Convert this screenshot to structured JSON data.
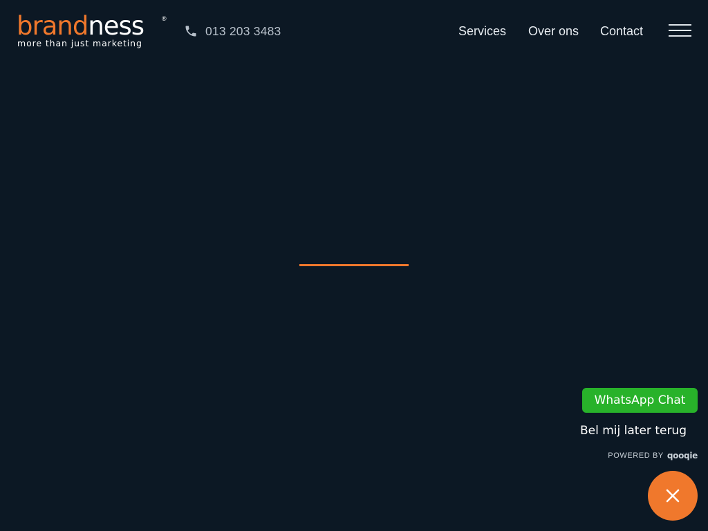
{
  "header": {
    "logo": {
      "word_part1": "brand",
      "word_part2": "ness",
      "registered": "®",
      "tagline": "more than just marketing"
    },
    "phone": {
      "icon": "phone-icon",
      "number": "013 203 3483"
    },
    "nav": {
      "items": [
        {
          "label": "Services"
        },
        {
          "label": "Over ons"
        },
        {
          "label": "Contact"
        }
      ],
      "menu_icon": "hamburger-menu-icon"
    }
  },
  "loader": {
    "progress": 1.0,
    "color": "#f0782c"
  },
  "widget": {
    "whatsapp_label": "WhatsApp Chat",
    "callback_label": "Bel mij later terug",
    "powered_by_label": "POWERED BY",
    "powered_by_brand": "QOOQIE",
    "close_icon": "close-icon"
  },
  "colors": {
    "background": "#0c1824",
    "brand_orange": "#f0782c",
    "whatsapp_green": "#28b22a",
    "nav_text": "#e6ebf0",
    "muted_text": "#b7c0ca"
  }
}
